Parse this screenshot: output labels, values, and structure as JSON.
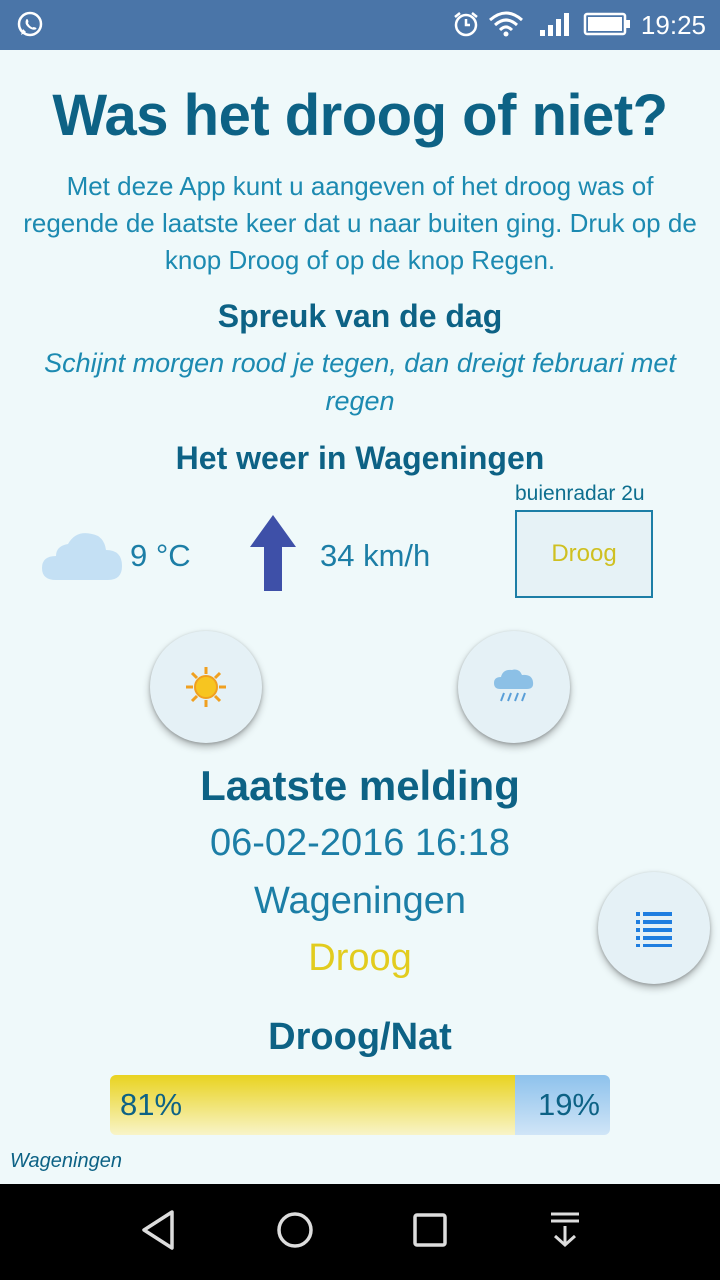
{
  "status": {
    "time": "19:25"
  },
  "title": "Was het droog of niet?",
  "intro": "Met deze App kunt u aangeven of het droog was of regende de laatste keer dat u naar buiten ging. Druk op de knop Droog of op de knop Regen.",
  "saying": {
    "heading": "Spreuk van de dag",
    "text": "Schijnt morgen rood je tegen, dan dreigt februari met regen"
  },
  "weather": {
    "heading": "Het weer in Wageningen",
    "temperature": "9 °C",
    "wind": "34 km/h",
    "condition_icon": "cloud-icon",
    "wind_icon": "wind-direction-arrow-icon"
  },
  "radar": {
    "label": "buienradar 2u",
    "value": "Droog"
  },
  "buttons": {
    "dry_icon": "sun-icon",
    "rain_icon": "rain-cloud-icon",
    "list_icon": "list-icon"
  },
  "last_report": {
    "heading": "Laatste melding",
    "datetime": "06-02-2016 16:18",
    "location": "Wageningen",
    "result": "Droog"
  },
  "ratio": {
    "heading": "Droog/Nat",
    "dry_label": "81%",
    "wet_label": "19%",
    "dry_fraction": 0.81,
    "wet_fraction": 0.19
  },
  "footer_location": "Wageningen",
  "colors": {
    "title": "#0d6285",
    "text": "#1c8ab1",
    "dry_yellow": "#e9d320",
    "wet_blue": "#8ec2ec",
    "status_bar": "#4a75a8"
  }
}
